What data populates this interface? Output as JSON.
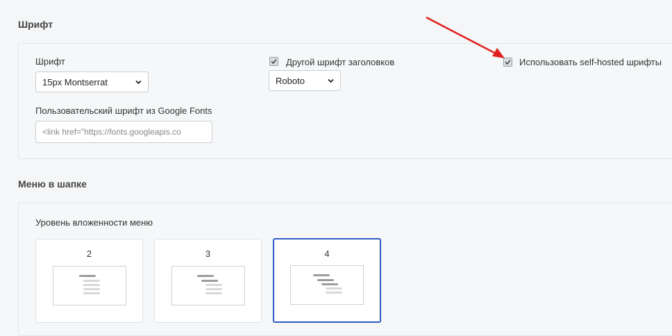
{
  "font_section": {
    "title": "Шрифт",
    "font_label": "Шрифт",
    "font_select_value": "15px Montserrat",
    "heading_font_checkbox_label": "Другой шрифт заголовков",
    "heading_font_select_value": "Roboto",
    "self_hosted_checkbox_label": "Использовать self-hosted шрифты",
    "google_fonts_label": "Пользовательский шрифт из Google Fonts",
    "google_fonts_input_placeholder": "<link href=\"https://fonts.googleapis.co"
  },
  "menu_section": {
    "title": "Меню в шапке",
    "nesting_label": "Уровень вложенности меню",
    "options": [
      {
        "label": "2",
        "selected": false
      },
      {
        "label": "3",
        "selected": false
      },
      {
        "label": "4",
        "selected": true
      }
    ]
  },
  "colors": {
    "selected_border": "#2e5bc7",
    "annotation_arrow": "#e02020"
  }
}
